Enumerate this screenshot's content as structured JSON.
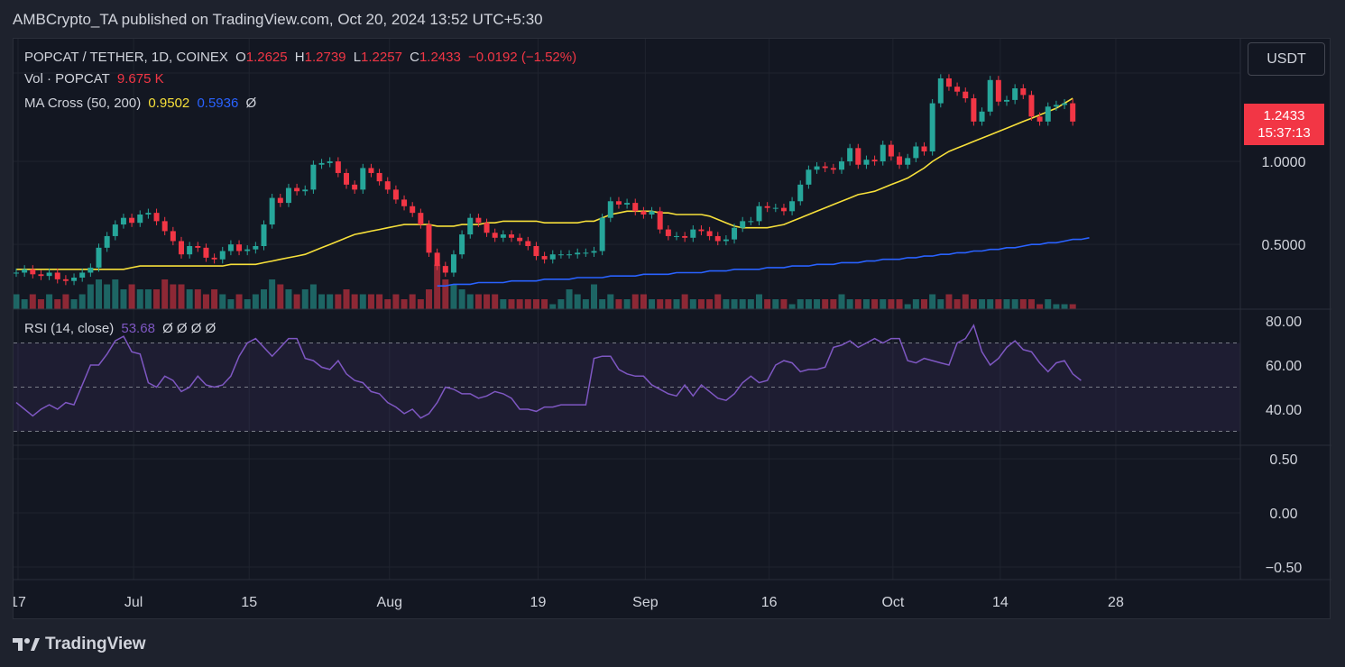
{
  "header": {
    "published": "AMBCrypto_TA published on TradingView.com, Oct 20, 2024 13:52 UTC+5:30"
  },
  "legend": {
    "symbol": "POPCAT / TETHER, 1D, COINEX",
    "o_label": "O",
    "o": "1.2625",
    "h_label": "H",
    "h": "1.2739",
    "l_label": "L",
    "l": "1.2257",
    "c_label": "C",
    "c": "1.2433",
    "change": "−0.0192 (−1.52%)",
    "vol_label": "Vol · POPCAT",
    "vol": "9.675 K",
    "ma_label": "MA Cross (50, 200)",
    "ma50": "0.9502",
    "ma200": "0.5936",
    "ma_icon": "Ø",
    "rsi_label": "RSI (14, close)",
    "rsi": "53.68",
    "rsi_icons": "Ø Ø Ø Ø"
  },
  "toolbar": {
    "currency": "USDT"
  },
  "price_tag": {
    "price": "1.2433",
    "countdown": "15:37:13"
  },
  "footer": {
    "brand": "TradingView"
  },
  "colors": {
    "up": "#26a69a",
    "down": "#f23645",
    "ma50": "#f7e03a",
    "ma200": "#2962ff",
    "rsi": "#7e57c2"
  },
  "chart_data": [
    {
      "type": "candlestick",
      "title": "POPCAT / TETHER, 1D, COINEX",
      "y_ticks": [
        "1.0000",
        "0.5000"
      ],
      "ylim": [
        0.0,
        1.5
      ],
      "x_ticks": [
        "17",
        "Jul",
        "15",
        "Aug",
        "19",
        "Sep",
        "16",
        "Oct",
        "14",
        "28"
      ],
      "x_tick_day_index": [
        0,
        14,
        28,
        45,
        63,
        76,
        91,
        106,
        119,
        133
      ],
      "close": [
        0.33,
        0.35,
        0.32,
        0.31,
        0.33,
        0.29,
        0.28,
        0.3,
        0.33,
        0.36,
        0.48,
        0.55,
        0.62,
        0.66,
        0.63,
        0.68,
        0.69,
        0.64,
        0.58,
        0.52,
        0.44,
        0.49,
        0.48,
        0.42,
        0.41,
        0.46,
        0.5,
        0.46,
        0.47,
        0.49,
        0.62,
        0.78,
        0.75,
        0.84,
        0.82,
        0.83,
        0.98,
        0.99,
        1.0,
        0.93,
        0.86,
        0.83,
        0.96,
        0.93,
        0.88,
        0.83,
        0.77,
        0.73,
        0.69,
        0.62,
        0.45,
        0.37,
        0.33,
        0.44,
        0.56,
        0.66,
        0.63,
        0.57,
        0.54,
        0.56,
        0.54,
        0.52,
        0.49,
        0.43,
        0.41,
        0.44,
        0.44,
        0.44,
        0.45,
        0.45,
        0.46,
        0.66,
        0.76,
        0.74,
        0.75,
        0.7,
        0.68,
        0.7,
        0.59,
        0.55,
        0.55,
        0.54,
        0.59,
        0.58,
        0.55,
        0.52,
        0.53,
        0.6,
        0.64,
        0.64,
        0.73,
        0.72,
        0.72,
        0.7,
        0.76,
        0.86,
        0.95,
        0.97,
        0.96,
        0.95,
        1.0,
        1.08,
        0.98,
        1.01,
        1.0,
        1.1,
        1.03,
        0.98,
        1.02,
        1.09,
        1.06,
        1.35,
        1.5,
        1.45,
        1.42,
        1.38,
        1.24,
        1.3,
        1.49,
        1.36,
        1.37,
        1.44,
        1.4,
        1.27,
        1.24,
        1.33,
        1.34,
        1.35,
        1.24
      ]
    },
    {
      "type": "line",
      "series": [
        {
          "name": "MA Cross (50, 200)",
          "role": "ma50",
          "start_index": 0,
          "values": [
            0.35,
            0.35,
            0.35,
            0.35,
            0.35,
            0.35,
            0.35,
            0.35,
            0.35,
            0.35,
            0.35,
            0.35,
            0.35,
            0.35,
            0.36,
            0.37,
            0.37,
            0.37,
            0.37,
            0.37,
            0.37,
            0.37,
            0.37,
            0.37,
            0.37,
            0.37,
            0.38,
            0.38,
            0.38,
            0.38,
            0.39,
            0.4,
            0.41,
            0.42,
            0.43,
            0.44,
            0.46,
            0.48,
            0.5,
            0.52,
            0.54,
            0.56,
            0.57,
            0.58,
            0.59,
            0.6,
            0.61,
            0.62,
            0.62,
            0.62,
            0.62,
            0.61,
            0.61,
            0.61,
            0.62,
            0.62,
            0.62,
            0.63,
            0.63,
            0.64,
            0.64,
            0.64,
            0.64,
            0.64,
            0.63,
            0.63,
            0.63,
            0.63,
            0.63,
            0.64,
            0.64,
            0.66,
            0.68,
            0.69,
            0.7,
            0.7,
            0.7,
            0.7,
            0.69,
            0.69,
            0.68,
            0.68,
            0.68,
            0.68,
            0.67,
            0.65,
            0.63,
            0.61,
            0.6,
            0.6,
            0.6,
            0.6,
            0.61,
            0.62,
            0.64,
            0.66,
            0.68,
            0.7,
            0.72,
            0.74,
            0.76,
            0.78,
            0.8,
            0.81,
            0.82,
            0.84,
            0.86,
            0.88,
            0.9,
            0.93,
            0.96,
            1.0,
            1.03,
            1.06,
            1.08,
            1.1,
            1.12,
            1.14,
            1.16,
            1.18,
            1.2,
            1.22,
            1.24,
            1.26,
            1.28,
            1.3,
            1.32,
            1.35,
            1.38
          ]
        },
        {
          "name": "MA Cross (50, 200)",
          "role": "ma200",
          "start_index": 51,
          "values": [
            0.25,
            0.25,
            0.26,
            0.26,
            0.26,
            0.27,
            0.27,
            0.27,
            0.27,
            0.28,
            0.28,
            0.28,
            0.28,
            0.29,
            0.29,
            0.29,
            0.29,
            0.3,
            0.3,
            0.3,
            0.3,
            0.31,
            0.31,
            0.31,
            0.31,
            0.32,
            0.32,
            0.32,
            0.32,
            0.33,
            0.33,
            0.33,
            0.33,
            0.34,
            0.34,
            0.34,
            0.35,
            0.35,
            0.35,
            0.35,
            0.36,
            0.36,
            0.36,
            0.37,
            0.37,
            0.37,
            0.38,
            0.38,
            0.38,
            0.39,
            0.39,
            0.39,
            0.4,
            0.4,
            0.41,
            0.41,
            0.41,
            0.42,
            0.42,
            0.43,
            0.43,
            0.44,
            0.44,
            0.45,
            0.45,
            0.46,
            0.46,
            0.47,
            0.47,
            0.48,
            0.48,
            0.49,
            0.5,
            0.5,
            0.51,
            0.51,
            0.52,
            0.53,
            0.53,
            0.54
          ]
        }
      ]
    },
    {
      "type": "bar",
      "title": "Vol · POPCAT",
      "values": [
        3,
        2,
        3,
        2,
        3,
        2,
        3,
        2,
        3,
        5,
        6,
        5,
        6,
        4,
        5,
        4,
        4,
        4,
        6,
        5,
        5,
        4,
        4,
        3,
        4,
        3,
        2,
        3,
        2,
        3,
        4,
        6,
        5,
        4,
        3,
        4,
        5,
        3,
        3,
        3,
        4,
        3,
        3,
        3,
        3,
        2,
        3,
        2,
        3,
        2,
        4,
        9,
        6,
        5,
        4,
        3,
        3,
        3,
        3,
        2,
        2,
        2,
        2,
        2,
        2,
        1,
        2,
        4,
        3,
        2,
        5,
        2,
        3,
        2,
        2,
        3,
        3,
        2,
        2,
        2,
        2,
        3,
        2,
        2,
        2,
        3,
        2,
        2,
        2,
        2,
        3,
        2,
        2,
        2,
        1,
        2,
        2,
        2,
        2,
        2,
        3,
        2,
        2,
        2,
        2,
        2,
        2,
        2,
        1,
        2,
        2,
        3,
        2,
        3,
        2,
        3,
        2,
        2,
        2,
        2,
        2,
        2,
        2,
        2,
        1,
        2,
        1,
        1,
        1
      ]
    },
    {
      "type": "line",
      "title": "RSI (14, close)",
      "y_ticks": [
        "80.00",
        "60.00",
        "40.00"
      ],
      "ylim": [
        28,
        82
      ],
      "bands": [
        30,
        50,
        70
      ],
      "series": [
        {
          "name": "RSI (14, close)",
          "values": [
            43,
            40,
            37,
            40,
            42,
            40,
            43,
            42,
            51,
            60,
            60,
            65,
            71,
            73,
            66,
            65,
            52,
            50,
            55,
            53,
            48,
            50,
            55,
            51,
            50,
            51,
            55,
            64,
            70,
            72,
            68,
            64,
            68,
            72,
            72,
            63,
            62,
            59,
            58,
            62,
            56,
            53,
            52,
            48,
            47,
            43,
            41,
            38,
            40,
            36,
            38,
            43,
            50,
            49,
            47,
            47,
            45,
            46,
            48,
            47,
            45,
            40,
            40,
            39,
            41,
            41,
            42,
            42,
            42,
            42,
            63,
            64,
            64,
            58,
            56,
            55,
            55,
            51,
            49,
            47,
            46,
            51,
            46,
            51,
            48,
            45,
            44,
            47,
            52,
            55,
            52,
            53,
            60,
            62,
            61,
            57,
            58,
            58,
            59,
            68,
            69,
            71,
            68,
            70,
            72,
            70,
            72,
            72,
            62,
            61,
            63,
            62,
            61,
            60,
            70,
            72,
            78,
            66,
            60,
            63,
            68,
            71,
            67,
            66,
            61,
            57,
            61,
            62,
            56,
            53
          ]
        }
      ]
    },
    {
      "type": "line",
      "title": "",
      "y_ticks": [
        "0.50",
        "0.00",
        "−0.50"
      ],
      "ylim": [
        -0.6,
        0.6
      ],
      "series": []
    }
  ]
}
